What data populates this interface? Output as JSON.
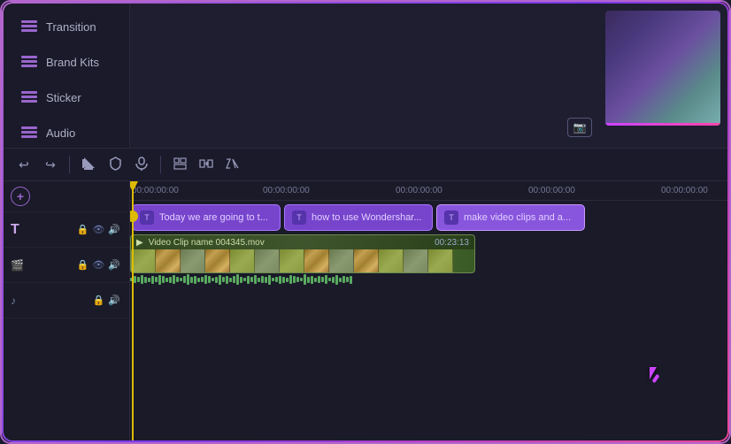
{
  "sidebar": {
    "items": [
      {
        "label": "Transition",
        "icon": "stack-icon"
      },
      {
        "label": "Brand Kits",
        "icon": "stack-icon"
      },
      {
        "label": "Sticker",
        "icon": "stack-icon"
      },
      {
        "label": "Audio",
        "icon": "stack-icon"
      }
    ]
  },
  "toolbar": {
    "undo_label": "↩",
    "redo_label": "↪",
    "crop_label": "⌐",
    "edit_label": "◻",
    "mic_label": "🎤",
    "layout_label": "⊞",
    "transition_label": "⇄",
    "speed_label": "⏩"
  },
  "timeline": {
    "time_markers": [
      "00:00:00:00",
      "00:00:00:00",
      "00:00:00:00",
      "00:00:00:00",
      "00:00:00:00"
    ],
    "subtitle_clips": [
      {
        "text": "Today we are going to t...",
        "icon": "T"
      },
      {
        "text": "how to use Wondershar...",
        "icon": "T"
      },
      {
        "text": "make video clips and a...",
        "icon": "T"
      }
    ],
    "video_clip": {
      "name": "Video Clip name 004345.mov",
      "duration": "00:23:13",
      "icon": "▶"
    }
  },
  "track_controls": {
    "add_track": "+",
    "text_track_icon": "T",
    "video_icons": [
      "🎬",
      "🔒",
      "👁",
      "🔊"
    ],
    "audio_icons": [
      "♪",
      "🔒",
      "🔊"
    ]
  }
}
